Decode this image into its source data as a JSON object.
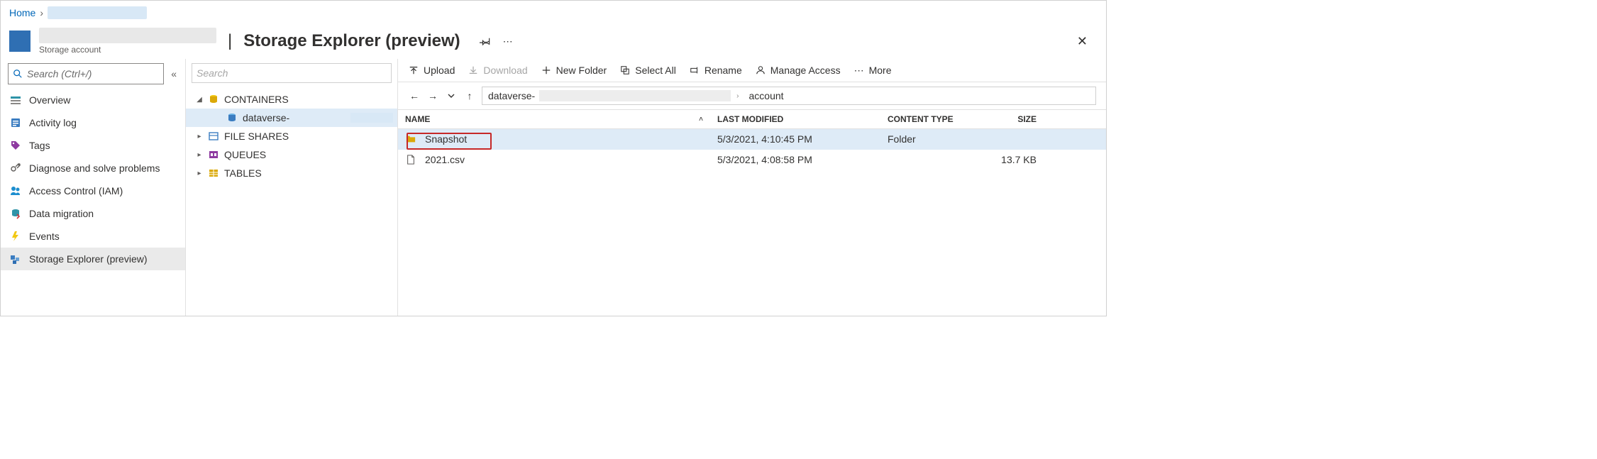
{
  "breadcrumb": {
    "home": "Home"
  },
  "header": {
    "page_title": "Storage Explorer (preview)",
    "subtitle": "Storage account"
  },
  "sidebar": {
    "search_placeholder": "Search (Ctrl+/)",
    "items": [
      {
        "label": "Overview",
        "icon": "overview"
      },
      {
        "label": "Activity log",
        "icon": "activity"
      },
      {
        "label": "Tags",
        "icon": "tags"
      },
      {
        "label": "Diagnose and solve problems",
        "icon": "diagnose"
      },
      {
        "label": "Access Control (IAM)",
        "icon": "iam"
      },
      {
        "label": "Data migration",
        "icon": "migration"
      },
      {
        "label": "Events",
        "icon": "events"
      },
      {
        "label": "Storage Explorer (preview)",
        "icon": "explorer",
        "active": true
      }
    ]
  },
  "tree": {
    "search_placeholder": "Search",
    "nodes": [
      {
        "label": "CONTAINERS",
        "icon": "containers",
        "expanded": true,
        "depth": 1,
        "children": [
          {
            "label": "dataverse-",
            "icon": "container",
            "depth": 2,
            "selected": true
          }
        ]
      },
      {
        "label": "FILE SHARES",
        "icon": "fileshares",
        "expanded": false,
        "depth": 1
      },
      {
        "label": "QUEUES",
        "icon": "queues",
        "expanded": false,
        "depth": 1
      },
      {
        "label": "TABLES",
        "icon": "tables",
        "expanded": false,
        "depth": 1
      }
    ]
  },
  "toolbar": {
    "upload": "Upload",
    "download": "Download",
    "newfolder": "New Folder",
    "selectall": "Select All",
    "rename": "Rename",
    "manage": "Manage Access",
    "more": "More"
  },
  "path": {
    "seg1": "dataverse-",
    "seg2": "account"
  },
  "table": {
    "headers": {
      "name": "NAME",
      "modified": "LAST MODIFIED",
      "type": "CONTENT TYPE",
      "size": "SIZE"
    },
    "rows": [
      {
        "name": "Snapshot",
        "modified": "5/3/2021, 4:10:45 PM",
        "type": "Folder",
        "size": "",
        "kind": "folder",
        "selected": true,
        "highlight": true
      },
      {
        "name": "2021.csv",
        "modified": "5/3/2021, 4:08:58 PM",
        "type": "",
        "size": "13.7 KB",
        "kind": "file"
      }
    ]
  }
}
